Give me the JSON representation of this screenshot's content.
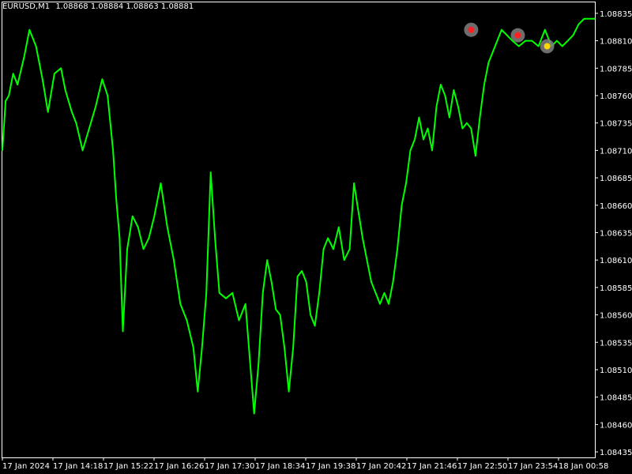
{
  "header": {
    "symbol_tf": "EURUSD,M1",
    "ohlc": "1.08868 1.08884 1.08863 1.08881"
  },
  "colors": {
    "background": "#000000",
    "price_line": "#00ff00",
    "frame": "#ffffff",
    "text": "#ffffff",
    "marker_outer": "#808080",
    "marker_red": "#ff2020",
    "marker_yellow": "#ffd700"
  },
  "chart_data": {
    "type": "line",
    "title": "",
    "xlabel": "",
    "ylabel": "",
    "ylim": [
      1.0843,
      1.08845
    ],
    "grid": false,
    "y_ticks": [
      1.08835,
      1.0881,
      1.08785,
      1.0876,
      1.08735,
      1.0871,
      1.08685,
      1.0866,
      1.08635,
      1.0861,
      1.08585,
      1.0856,
      1.08535,
      1.0851,
      1.08485,
      1.0846,
      1.08435
    ],
    "y_tick_labels": [
      "1.08835",
      "1.08810",
      "1.08785",
      "1.08760",
      "1.08735",
      "1.08710",
      "1.08685",
      "1.08660",
      "1.08635",
      "1.08610",
      "1.08585",
      "1.08560",
      "1.08535",
      "1.08510",
      "1.08485",
      "1.08460",
      "1.08435"
    ],
    "x_tick_labels": [
      "17 Jan 2024",
      "17 Jan 14:18",
      "17 Jan 15:22",
      "17 Jan 16:26",
      "17 Jan 17:30",
      "17 Jan 18:34",
      "17 Jan 19:38",
      "17 Jan 20:42",
      "17 Jan 21:46",
      "17 Jan 22:50",
      "17 Jan 23:54",
      "18 Jan 00:58"
    ],
    "series": [
      {
        "points": [
          {
            "t": 0,
            "p": 1.0871
          },
          {
            "t": 3,
            "p": 1.08755
          },
          {
            "t": 6,
            "p": 1.0876
          },
          {
            "t": 10,
            "p": 1.0878
          },
          {
            "t": 14,
            "p": 1.0877
          },
          {
            "t": 20,
            "p": 1.08795
          },
          {
            "t": 25,
            "p": 1.0882
          },
          {
            "t": 31,
            "p": 1.08805
          },
          {
            "t": 37,
            "p": 1.08775
          },
          {
            "t": 42,
            "p": 1.08745
          },
          {
            "t": 48,
            "p": 1.0878
          },
          {
            "t": 54,
            "p": 1.08785
          },
          {
            "t": 58,
            "p": 1.08765
          },
          {
            "t": 64,
            "p": 1.08745
          },
          {
            "t": 68,
            "p": 1.08735
          },
          {
            "t": 74,
            "p": 1.0871
          },
          {
            "t": 80,
            "p": 1.0873
          },
          {
            "t": 86,
            "p": 1.0875
          },
          {
            "t": 92,
            "p": 1.08775
          },
          {
            "t": 97,
            "p": 1.0876
          },
          {
            "t": 102,
            "p": 1.0871
          },
          {
            "t": 105,
            "p": 1.08665
          },
          {
            "t": 108,
            "p": 1.0863
          },
          {
            "t": 111,
            "p": 1.08545
          },
          {
            "t": 115,
            "p": 1.0862
          },
          {
            "t": 120,
            "p": 1.0865
          },
          {
            "t": 125,
            "p": 1.0864
          },
          {
            "t": 130,
            "p": 1.0862
          },
          {
            "t": 135,
            "p": 1.0863
          },
          {
            "t": 140,
            "p": 1.0865
          },
          {
            "t": 146,
            "p": 1.0868
          },
          {
            "t": 152,
            "p": 1.0864
          },
          {
            "t": 158,
            "p": 1.0861
          },
          {
            "t": 164,
            "p": 1.0857
          },
          {
            "t": 170,
            "p": 1.08555
          },
          {
            "t": 176,
            "p": 1.0853
          },
          {
            "t": 180,
            "p": 1.0849
          },
          {
            "t": 184,
            "p": 1.0853
          },
          {
            "t": 188,
            "p": 1.0858
          },
          {
            "t": 192,
            "p": 1.0869
          },
          {
            "t": 196,
            "p": 1.0863
          },
          {
            "t": 200,
            "p": 1.0858
          },
          {
            "t": 206,
            "p": 1.08575
          },
          {
            "t": 212,
            "p": 1.0858
          },
          {
            "t": 218,
            "p": 1.08555
          },
          {
            "t": 224,
            "p": 1.0857
          },
          {
            "t": 228,
            "p": 1.0852
          },
          {
            "t": 232,
            "p": 1.0847
          },
          {
            "t": 236,
            "p": 1.08515
          },
          {
            "t": 240,
            "p": 1.0858
          },
          {
            "t": 244,
            "p": 1.0861
          },
          {
            "t": 248,
            "p": 1.0859
          },
          {
            "t": 252,
            "p": 1.08565
          },
          {
            "t": 256,
            "p": 1.0856
          },
          {
            "t": 260,
            "p": 1.0853
          },
          {
            "t": 264,
            "p": 1.0849
          },
          {
            "t": 268,
            "p": 1.0853
          },
          {
            "t": 272,
            "p": 1.08595
          },
          {
            "t": 276,
            "p": 1.086
          },
          {
            "t": 280,
            "p": 1.0859
          },
          {
            "t": 284,
            "p": 1.0856
          },
          {
            "t": 288,
            "p": 1.0855
          },
          {
            "t": 292,
            "p": 1.0858
          },
          {
            "t": 296,
            "p": 1.0862
          },
          {
            "t": 300,
            "p": 1.0863
          },
          {
            "t": 305,
            "p": 1.0862
          },
          {
            "t": 310,
            "p": 1.0864
          },
          {
            "t": 315,
            "p": 1.0861
          },
          {
            "t": 320,
            "p": 1.0862
          },
          {
            "t": 324,
            "p": 1.0868
          },
          {
            "t": 328,
            "p": 1.08655
          },
          {
            "t": 332,
            "p": 1.0863
          },
          {
            "t": 336,
            "p": 1.0861
          },
          {
            "t": 340,
            "p": 1.0859
          },
          {
            "t": 344,
            "p": 1.0858
          },
          {
            "t": 348,
            "p": 1.0857
          },
          {
            "t": 352,
            "p": 1.0858
          },
          {
            "t": 356,
            "p": 1.0857
          },
          {
            "t": 360,
            "p": 1.0859
          },
          {
            "t": 364,
            "p": 1.0862
          },
          {
            "t": 368,
            "p": 1.0866
          },
          {
            "t": 372,
            "p": 1.0868
          },
          {
            "t": 376,
            "p": 1.0871
          },
          {
            "t": 380,
            "p": 1.0872
          },
          {
            "t": 384,
            "p": 1.0874
          },
          {
            "t": 388,
            "p": 1.0872
          },
          {
            "t": 392,
            "p": 1.0873
          },
          {
            "t": 396,
            "p": 1.0871
          },
          {
            "t": 400,
            "p": 1.0875
          },
          {
            "t": 404,
            "p": 1.0877
          },
          {
            "t": 408,
            "p": 1.0876
          },
          {
            "t": 412,
            "p": 1.0874
          },
          {
            "t": 416,
            "p": 1.08765
          },
          {
            "t": 420,
            "p": 1.0875
          },
          {
            "t": 424,
            "p": 1.0873
          },
          {
            "t": 428,
            "p": 1.08735
          },
          {
            "t": 432,
            "p": 1.0873
          },
          {
            "t": 436,
            "p": 1.08705
          },
          {
            "t": 440,
            "p": 1.0874
          },
          {
            "t": 444,
            "p": 1.0877
          },
          {
            "t": 448,
            "p": 1.0879
          },
          {
            "t": 452,
            "p": 1.088
          },
          {
            "t": 456,
            "p": 1.0881
          },
          {
            "t": 460,
            "p": 1.0882
          },
          {
            "t": 465,
            "p": 1.08815
          },
          {
            "t": 470,
            "p": 1.0881
          },
          {
            "t": 476,
            "p": 1.08805
          },
          {
            "t": 482,
            "p": 1.0881
          },
          {
            "t": 488,
            "p": 1.0881
          },
          {
            "t": 494,
            "p": 1.08805
          },
          {
            "t": 500,
            "p": 1.0882
          },
          {
            "t": 506,
            "p": 1.08805
          },
          {
            "t": 511,
            "p": 1.0881
          },
          {
            "t": 516,
            "p": 1.08805
          },
          {
            "t": 521,
            "p": 1.0881
          },
          {
            "t": 526,
            "p": 1.08815
          },
          {
            "t": 531,
            "p": 1.08825
          },
          {
            "t": 536,
            "p": 1.0883
          },
          {
            "t": 542,
            "p": 1.0883
          },
          {
            "t": 546,
            "p": 1.0883
          }
        ]
      }
    ],
    "markers": [
      {
        "t": 432,
        "p": 1.0882,
        "color": "red"
      },
      {
        "t": 475,
        "p": 1.08815,
        "color": "red"
      },
      {
        "t": 502,
        "p": 1.08805,
        "color": "yellow"
      }
    ]
  }
}
